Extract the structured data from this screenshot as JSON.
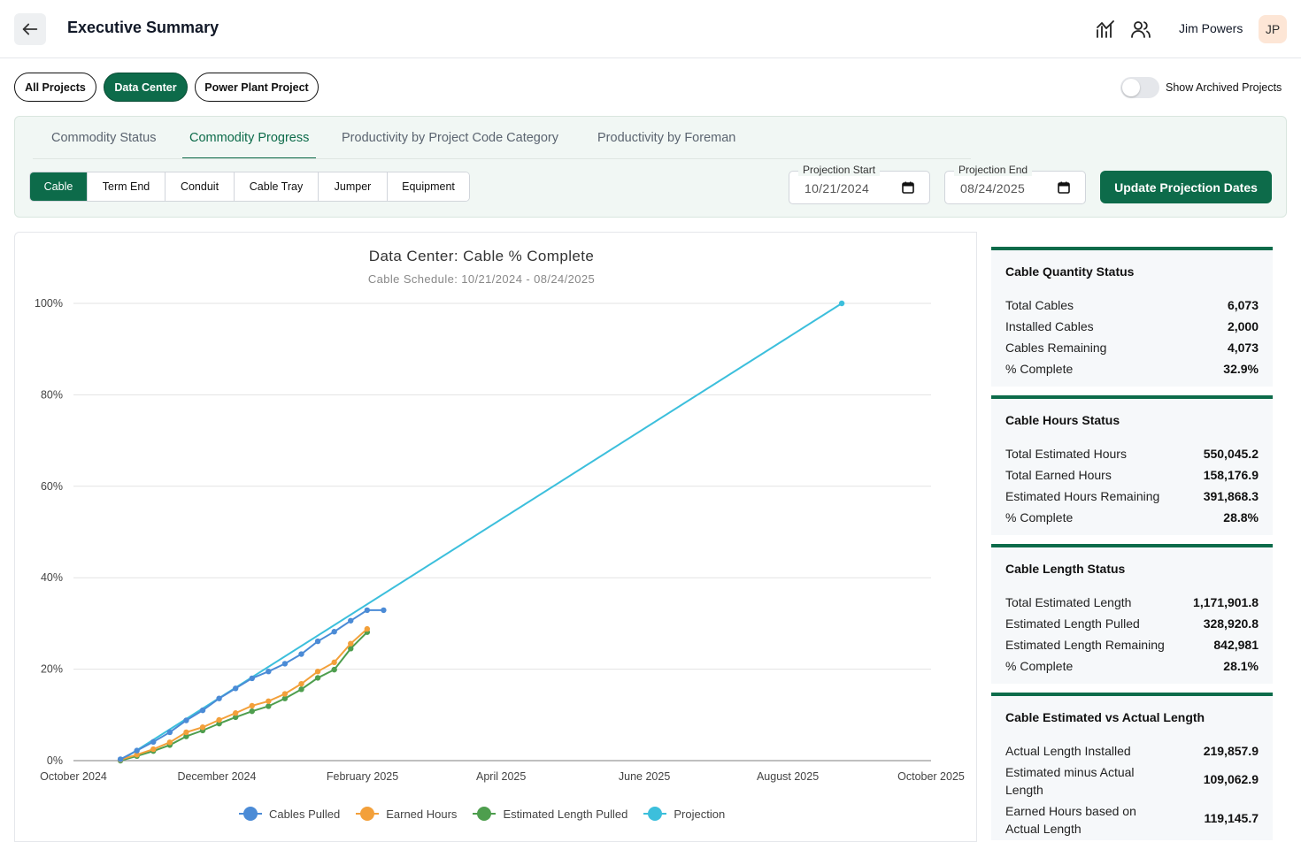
{
  "header": {
    "title": "Executive Summary",
    "user_name": "Jim Powers",
    "user_initials": "JP"
  },
  "projects": {
    "pills": [
      {
        "label": "All Projects",
        "active": false
      },
      {
        "label": "Data Center",
        "active": true
      },
      {
        "label": "Power Plant Project",
        "active": false
      }
    ],
    "show_archived_label": "Show Archived Projects",
    "show_archived_on": false
  },
  "tabs": [
    {
      "label": "Commodity Status",
      "active": false
    },
    {
      "label": "Commodity Progress",
      "active": true
    },
    {
      "label": "Productivity by Project Code Category",
      "active": false
    },
    {
      "label": "Productivity by Foreman",
      "active": false
    }
  ],
  "commodities": [
    {
      "label": "Cable",
      "active": true
    },
    {
      "label": "Term End",
      "active": false
    },
    {
      "label": "Conduit",
      "active": false
    },
    {
      "label": "Cable Tray",
      "active": false
    },
    {
      "label": "Jumper",
      "active": false
    },
    {
      "label": "Equipment",
      "active": false
    }
  ],
  "projection": {
    "start_label": "Projection Start",
    "start_value": "10/21/2024",
    "end_label": "Projection End",
    "end_value": "08/24/2025",
    "update_label": "Update Projection Dates"
  },
  "chart_data": {
    "type": "line",
    "title": "Data Center: Cable % Complete",
    "subtitle": "Cable Schedule: 10/21/2024 - 08/24/2025",
    "x_ticks": [
      "October 2024",
      "December 2024",
      "February 2025",
      "April 2025",
      "June 2025",
      "August 2025",
      "October 2025"
    ],
    "y_ticks": [
      "0%",
      "20%",
      "40%",
      "60%",
      "80%",
      "100%"
    ],
    "x_range": [
      "2024-10-01",
      "2025-10-01"
    ],
    "y_range": [
      0,
      100
    ],
    "grid": true,
    "legend_position": "bottom",
    "series": [
      {
        "name": "Cables Pulled",
        "color": "#4b8bd6",
        "x": [
          "2024-10-21",
          "2024-10-28",
          "2024-11-04",
          "2024-11-11",
          "2024-11-18",
          "2024-11-25",
          "2024-12-02",
          "2024-12-09",
          "2024-12-16",
          "2024-12-23",
          "2024-12-30",
          "2025-01-06",
          "2025-01-13",
          "2025-01-20",
          "2025-01-27",
          "2025-02-03",
          "2025-02-10"
        ],
        "y": [
          0.3,
          2.2,
          4.1,
          6.2,
          8.8,
          11.0,
          13.6,
          15.8,
          18.0,
          19.5,
          21.2,
          23.3,
          26.1,
          28.2,
          30.6,
          32.9,
          32.9
        ]
      },
      {
        "name": "Earned Hours",
        "color": "#f3a03a",
        "x": [
          "2024-10-21",
          "2024-10-28",
          "2024-11-04",
          "2024-11-11",
          "2024-11-18",
          "2024-11-25",
          "2024-12-02",
          "2024-12-09",
          "2024-12-16",
          "2024-12-23",
          "2024-12-30",
          "2025-01-06",
          "2025-01-13",
          "2025-01-20",
          "2025-01-27",
          "2025-02-03"
        ],
        "y": [
          0.2,
          1.3,
          2.5,
          4.0,
          6.2,
          7.3,
          8.9,
          10.4,
          12.0,
          13.0,
          14.6,
          16.8,
          19.5,
          21.5,
          25.6,
          28.8
        ]
      },
      {
        "name": "Estimated Length Pulled",
        "color": "#4e9e4e",
        "x": [
          "2024-10-21",
          "2024-10-28",
          "2024-11-04",
          "2024-11-11",
          "2024-11-18",
          "2024-11-25",
          "2024-12-02",
          "2024-12-09",
          "2024-12-16",
          "2024-12-23",
          "2024-12-30",
          "2025-01-06",
          "2025-01-13",
          "2025-01-20",
          "2025-01-27",
          "2025-02-03"
        ],
        "y": [
          0.0,
          1.0,
          2.1,
          3.4,
          5.3,
          6.6,
          8.1,
          9.5,
          10.8,
          11.9,
          13.6,
          15.6,
          18.1,
          19.9,
          24.5,
          28.1
        ]
      },
      {
        "name": "Projection",
        "color": "#3cbfdc",
        "x": [
          "2024-10-21",
          "2025-08-24"
        ],
        "y": [
          0,
          100
        ]
      }
    ]
  },
  "cards": [
    {
      "title": "Cable Quantity Status",
      "rows": [
        {
          "label": "Total Cables",
          "value": "6,073"
        },
        {
          "label": "Installed Cables",
          "value": "2,000"
        },
        {
          "label": "Cables Remaining",
          "value": "4,073"
        },
        {
          "label": "% Complete",
          "value": "32.9%"
        }
      ]
    },
    {
      "title": "Cable Hours Status",
      "rows": [
        {
          "label": "Total Estimated Hours",
          "value": "550,045.2"
        },
        {
          "label": "Total Earned Hours",
          "value": "158,176.9"
        },
        {
          "label": "Estimated Hours Remaining",
          "value": "391,868.3"
        },
        {
          "label": "% Complete",
          "value": "28.8%"
        }
      ]
    },
    {
      "title": "Cable Length Status",
      "rows": [
        {
          "label": "Total Estimated Length",
          "value": "1,171,901.8"
        },
        {
          "label": "Estimated Length Pulled",
          "value": "328,920.8"
        },
        {
          "label": "Estimated Length Remaining",
          "value": "842,981"
        },
        {
          "label": "% Complete",
          "value": "28.1%"
        }
      ]
    },
    {
      "title": "Cable Estimated vs Actual Length",
      "rows": [
        {
          "label": "Actual Length Installed",
          "value": "219,857.9"
        },
        {
          "label": "Estimated minus Actual Length",
          "value": "109,062.9"
        },
        {
          "label": "Earned Hours based on Actual Length",
          "value": "119,145.7"
        }
      ]
    }
  ]
}
